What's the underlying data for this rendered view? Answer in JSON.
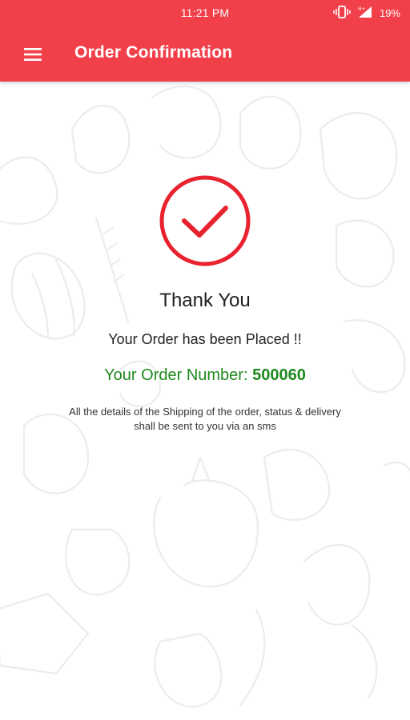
{
  "status_bar": {
    "time": "11:21 PM",
    "battery": "19%",
    "icons": [
      "vibrate-icon",
      "signal-icon",
      "battery-icon"
    ]
  },
  "app_bar": {
    "title": "Order Confirmation",
    "menu_icon": "hamburger-menu-icon",
    "color": "#f2404a"
  },
  "confirmation": {
    "icon": "check-circle-icon",
    "heading": "Thank You",
    "message": "Your Order has been Placed !!",
    "order_number_label": "Your Order Number: ",
    "order_number": "500060",
    "details": "All the details of the Shipping of the order, status & delivery shall be sent to you via an sms"
  },
  "colors": {
    "accent": "#f2404a",
    "check": "#e8232f",
    "order_number": "#1e8a1e"
  }
}
